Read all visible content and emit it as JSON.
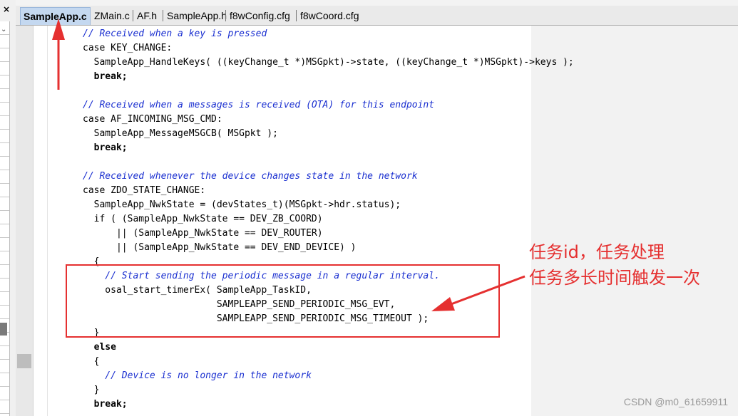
{
  "left_pane": {
    "close_glyph": "×"
  },
  "tabs": [
    {
      "label": "SampleApp.c",
      "active": true
    },
    {
      "label": "ZMain.c",
      "active": false
    },
    {
      "label": "AF.h",
      "active": false
    },
    {
      "label": "SampleApp.h",
      "active": false
    },
    {
      "label": "f8wConfig.cfg",
      "active": false
    },
    {
      "label": "f8wCoord.cfg",
      "active": false
    }
  ],
  "code_lines": [
    {
      "text": "// Received when a key is pressed",
      "kind": "comment"
    },
    {
      "text": "case KEY_CHANGE:",
      "kind": "code"
    },
    {
      "text": "  SampleApp_HandleKeys( ((keyChange_t *)MSGpkt)->state, ((keyChange_t *)MSGpkt)->keys );",
      "kind": "code"
    },
    {
      "text": "  break;",
      "kind": "bold"
    },
    {
      "text": "",
      "kind": "code"
    },
    {
      "text": "// Received when a messages is received (OTA) for this endpoint",
      "kind": "comment"
    },
    {
      "text": "case AF_INCOMING_MSG_CMD:",
      "kind": "code"
    },
    {
      "text": "  SampleApp_MessageMSGCB( MSGpkt );",
      "kind": "code"
    },
    {
      "text": "  break;",
      "kind": "bold"
    },
    {
      "text": "",
      "kind": "code"
    },
    {
      "text": "// Received whenever the device changes state in the network",
      "kind": "comment"
    },
    {
      "text": "case ZDO_STATE_CHANGE:",
      "kind": "code"
    },
    {
      "text": "  SampleApp_NwkState = (devStates_t)(MSGpkt->hdr.status);",
      "kind": "code"
    },
    {
      "text": "  if ( (SampleApp_NwkState == DEV_ZB_COORD)",
      "kind": "code"
    },
    {
      "text": "      || (SampleApp_NwkState == DEV_ROUTER)",
      "kind": "code"
    },
    {
      "text": "      || (SampleApp_NwkState == DEV_END_DEVICE) )",
      "kind": "code"
    },
    {
      "text": "  {",
      "kind": "code"
    },
    {
      "text": "    // Start sending the periodic message in a regular interval.",
      "kind": "comment"
    },
    {
      "text": "    osal_start_timerEx( SampleApp_TaskID,",
      "kind": "code"
    },
    {
      "text": "                        SAMPLEAPP_SEND_PERIODIC_MSG_EVT,",
      "kind": "code"
    },
    {
      "text": "                        SAMPLEAPP_SEND_PERIODIC_MSG_TIMEOUT );",
      "kind": "code"
    },
    {
      "text": "  }",
      "kind": "code"
    },
    {
      "text": "  else",
      "kind": "bold"
    },
    {
      "text": "  {",
      "kind": "code"
    },
    {
      "text": "    // Device is no longer in the network",
      "kind": "comment"
    },
    {
      "text": "  }",
      "kind": "code"
    },
    {
      "text": "  break;",
      "kind": "bold"
    }
  ],
  "annotation": {
    "line1": "任务id，任务处理",
    "line2": "任务多长时间触发一次",
    "color": "#e53030"
  },
  "watermark": "CSDN @m0_61659911"
}
